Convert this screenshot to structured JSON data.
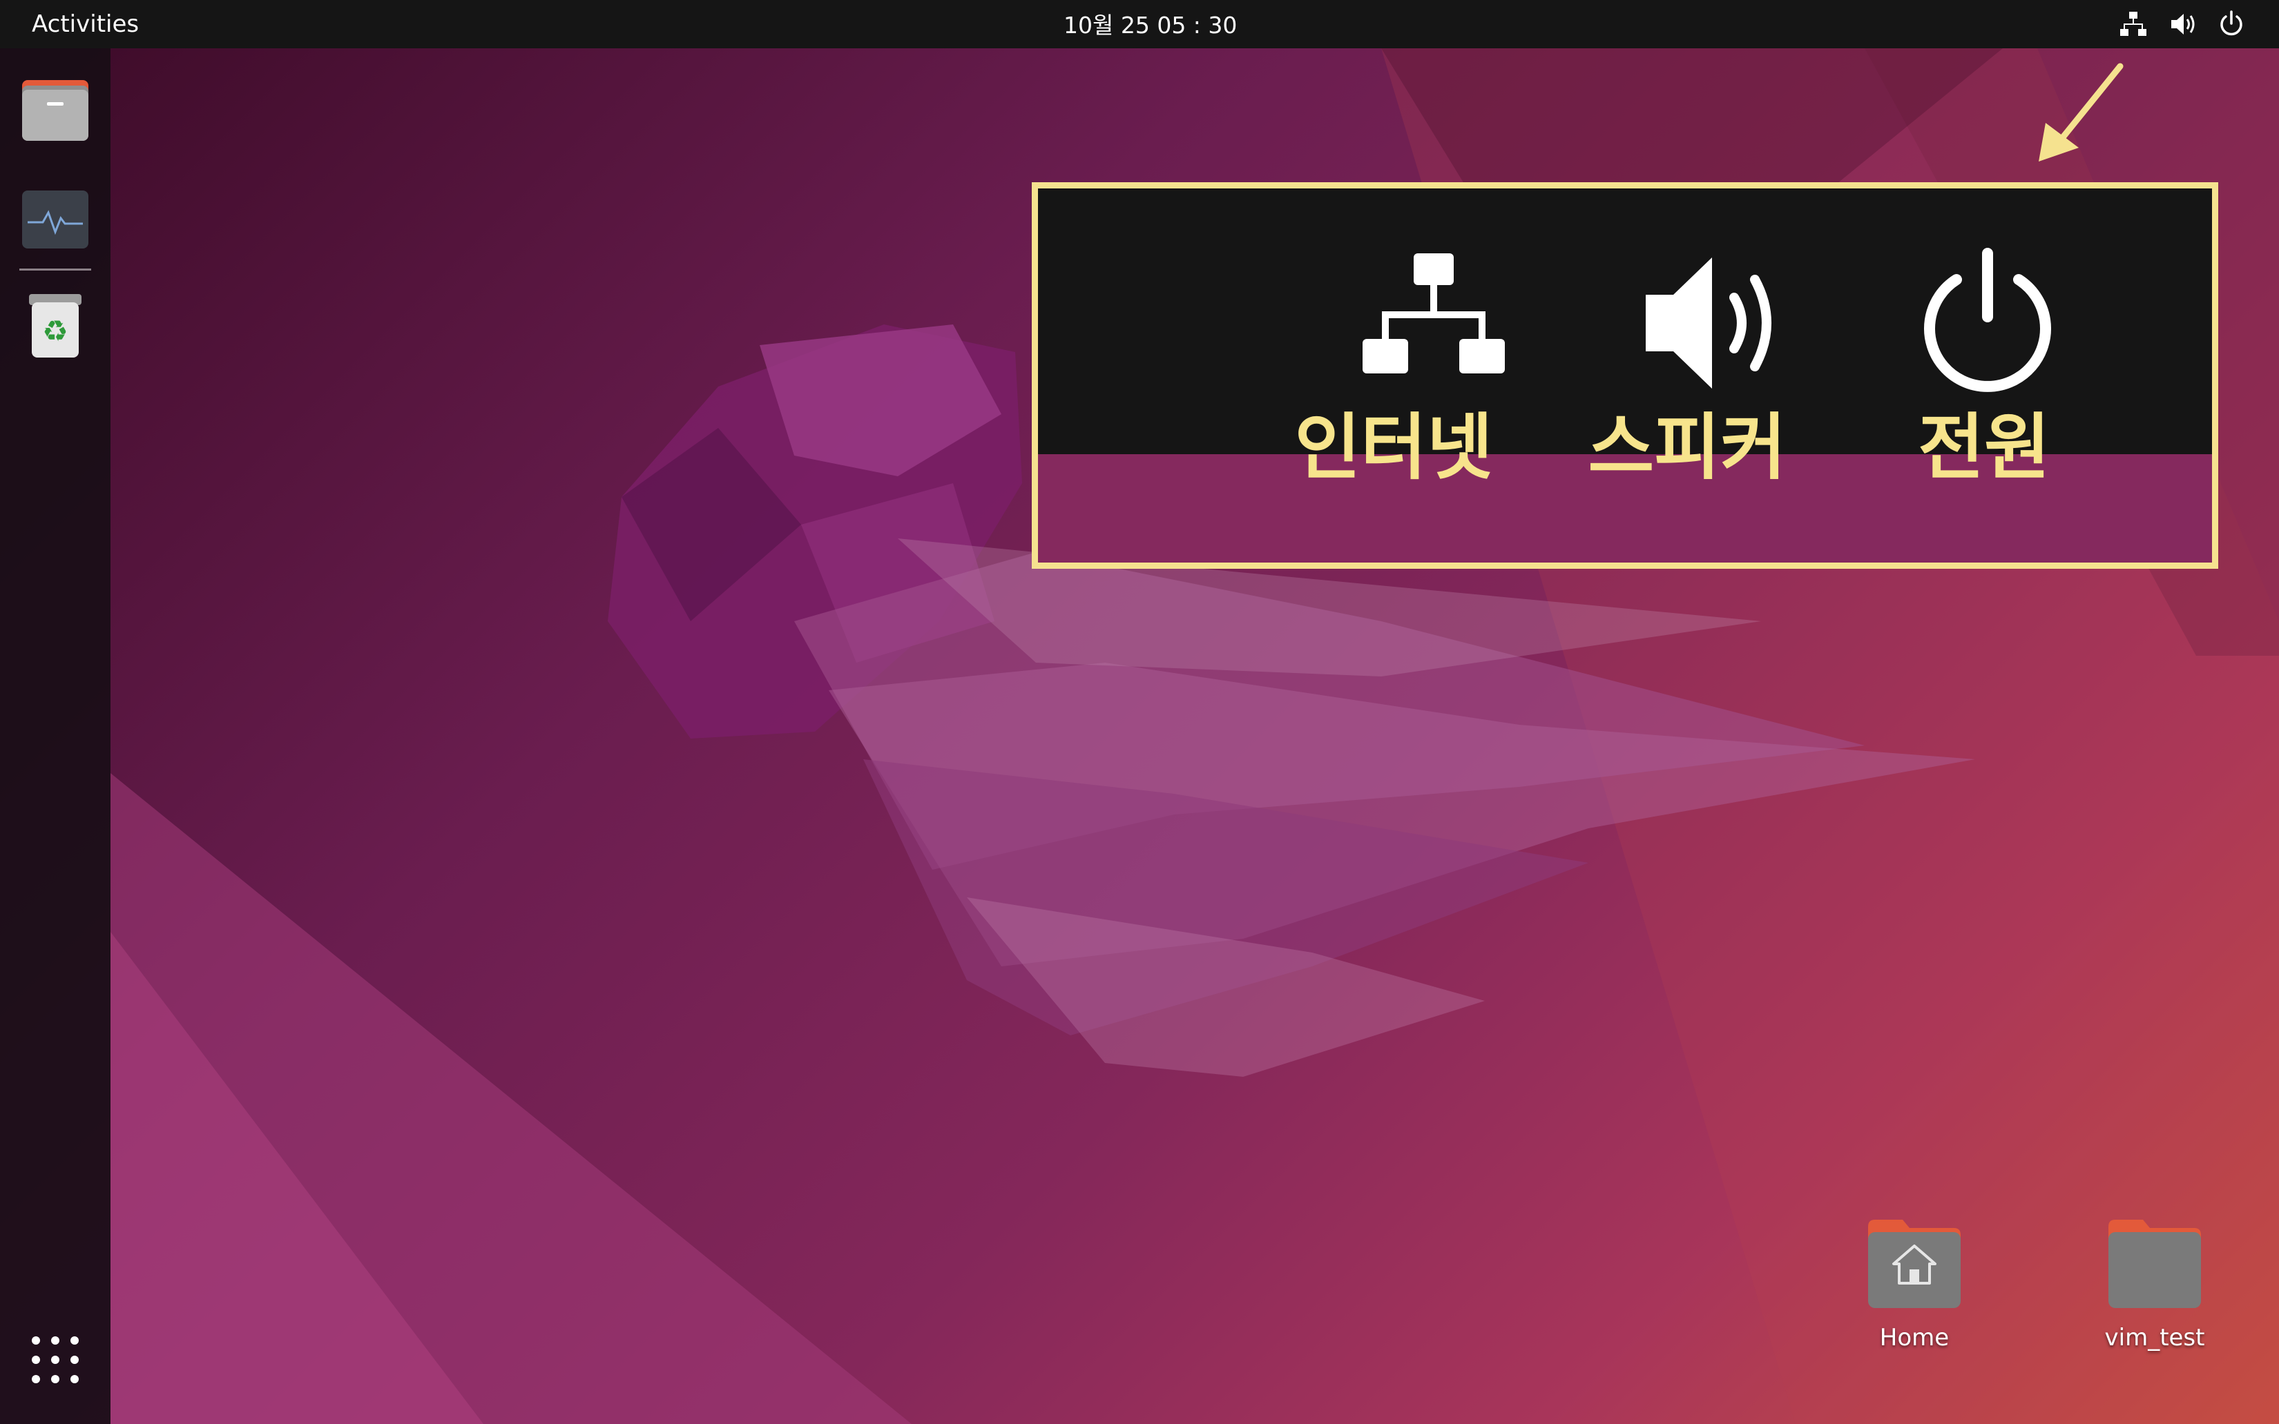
{
  "top_bar": {
    "activities_label": "Activities",
    "clock_text": "10월 25  05 : 30",
    "tray_icons": [
      "network-icon",
      "volume-icon",
      "power-icon"
    ]
  },
  "dock": {
    "apps": [
      "files-icon",
      "system-monitor-icon",
      "trash-icon"
    ],
    "show_apps_icon": "apps-grid-icon"
  },
  "callout": {
    "internet_label": "인터넷",
    "speaker_label": "스피커",
    "power_label": "전원",
    "border_color": "#f5e28f"
  },
  "desktop": {
    "icons": [
      {
        "label": "Home",
        "icon": "home-folder-icon"
      },
      {
        "label": "vim_test",
        "icon": "folder-icon"
      }
    ]
  },
  "colors": {
    "top_bar": "#151515",
    "callout_text": "#f7e48c",
    "folder": "#7a7a7a",
    "folder_tab": "#e35a3a"
  }
}
